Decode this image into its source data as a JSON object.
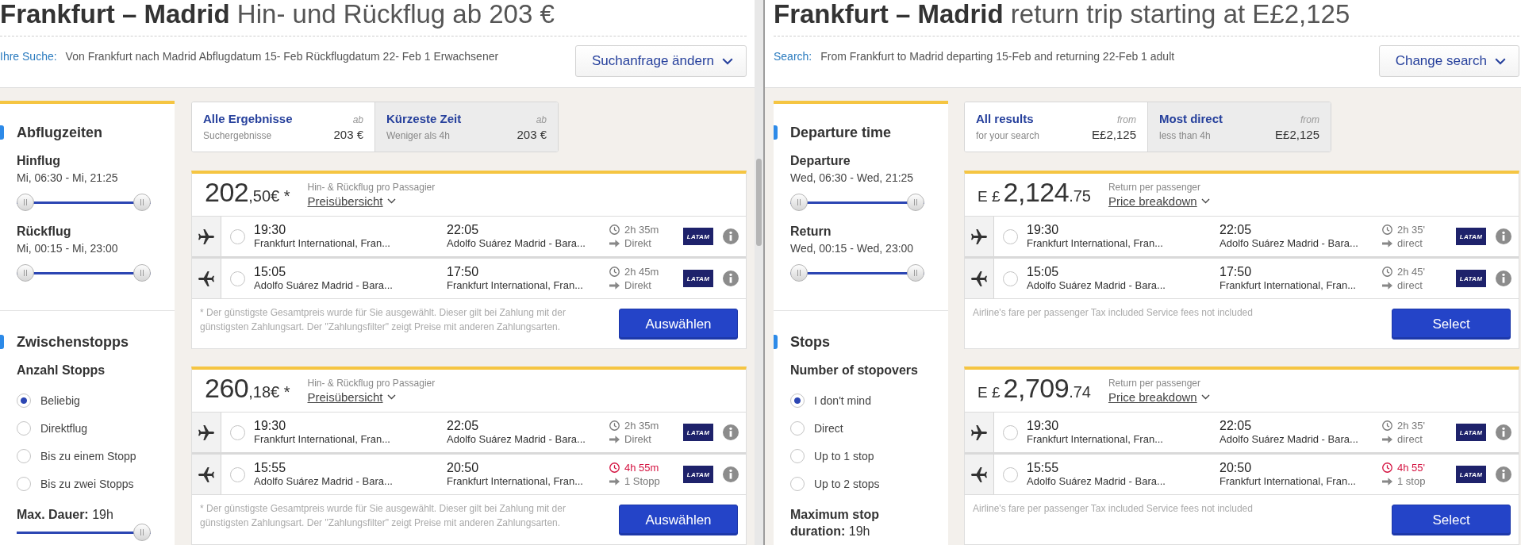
{
  "panes": [
    {
      "title": "**Frankfurt – Madrid** Hin- und Rückflug ab 203 €",
      "search": {
        "label": "Ihre Suche:",
        "summary": "Von Frankfurt nach Madrid Abflugdatum 15- Feb Rückflugdatum 22- Feb 1 Erwachsener",
        "button": "Suchanfrage ändern"
      },
      "sidebar": {
        "times": {
          "heading": "Abflugzeiten",
          "groups": [
            {
              "label": "Hinflug",
              "range": "Mi, 06:30 - Mi, 21:25",
              "level": 1
            },
            {
              "label": "Rückflug",
              "range": "Mi, 00:15 - Mi, 23:00",
              "level": 1
            }
          ]
        },
        "stops": {
          "heading": "Zwischenstopps",
          "subheading": "Anzahl Stopps",
          "options": [
            {
              "label": "Beliebig",
              "selected": true
            },
            {
              "label": "Direktflug",
              "selected": false
            },
            {
              "label": "Bis zu einem Stopp",
              "selected": false
            },
            {
              "label": "Bis zu zwei Stopps",
              "selected": false
            }
          ],
          "max_duration": "**Max. Dauer:** 19h",
          "level": 1
        }
      },
      "tabs": [
        {
          "title": "Alle Ergebnisse",
          "subtitle": "Suchergebnisse",
          "prefix": "ab",
          "price": "203 €",
          "selected": true
        },
        {
          "title": "Kürzeste Zeit",
          "subtitle": "Weniger als 4h",
          "prefix": "ab",
          "price": "203 €",
          "selected": false
        }
      ],
      "results": [
        {
          "price": {
            "amount": "202",
            "fraction": ",50€ *"
          },
          "fare_label": "Hin- & Rückflug pro Passagier",
          "breakdown": "Preisübersicht",
          "legs": [
            {
              "kind": "outbound",
              "selected": false,
              "depart_time": "19:30",
              "depart_airport": "Frankfurt International, Fran...",
              "arrive_time": "22:05",
              "arrive_airport": "Adolfo Suárez Madrid - Bara...",
              "duration": "2h 35m",
              "alert": false,
              "stops": "Direkt",
              "airline": "LATAM"
            },
            {
              "kind": "return",
              "selected": false,
              "depart_time": "15:05",
              "depart_airport": "Adolfo Suárez Madrid - Bara...",
              "arrive_time": "17:50",
              "arrive_airport": "Frankfurt International, Fran...",
              "duration": "2h 45m",
              "alert": false,
              "stops": "Direkt",
              "airline": "LATAM"
            }
          ],
          "note": "* Der günstigste Gesamtpreis wurde für Sie ausgewählt. Dieser gilt bei Zahlung mit der günstigsten Zahlungsart. Der \"Zahlungsfilter\" zeigt Preise mit anderen Zahlungsarten.",
          "button": "Auswählen"
        },
        {
          "price": {
            "amount": "260",
            "fraction": ",18€ *"
          },
          "fare_label": "Hin- & Rückflug pro Passagier",
          "breakdown": "Preisübersicht",
          "legs": [
            {
              "kind": "outbound",
              "selected": false,
              "depart_time": "19:30",
              "depart_airport": "Frankfurt International, Fran...",
              "arrive_time": "22:05",
              "arrive_airport": "Adolfo Suárez Madrid - Bara...",
              "duration": "2h 35m",
              "alert": false,
              "stops": "Direkt",
              "airline": "LATAM"
            },
            {
              "kind": "return",
              "selected": false,
              "depart_time": "15:55",
              "depart_airport": "Adolfo Suárez Madrid - Bara...",
              "arrive_time": "20:50",
              "arrive_airport": "Frankfurt International, Fran...",
              "duration": "4h 55m",
              "alert": true,
              "stops": "1 Stopp",
              "airline": "LATAM"
            }
          ],
          "note": "* Der günstigste Gesamtpreis wurde für Sie ausgewählt. Dieser gilt bei Zahlung mit der günstigsten Zahlungsart. Der \"Zahlungsfilter\" zeigt Preise mit anderen Zahlungsarten.",
          "button": "Auswählen"
        }
      ]
    },
    {
      "title": "**Frankfurt – Madrid** return trip starting at E£2,125",
      "search": {
        "label": "Search:",
        "summary": "From Frankfurt to Madrid departing 15-Feb and returning 22-Feb 1 adult",
        "button": "Change search"
      },
      "sidebar": {
        "times": {
          "heading": "Departure time",
          "groups": [
            {
              "label": "Departure",
              "range": "Wed, 06:30 - Wed, 21:25",
              "level": 1
            },
            {
              "label": "Return",
              "range": "Wed, 00:15 - Wed, 23:00",
              "level": 1
            }
          ]
        },
        "stops": {
          "heading": "Stops",
          "subheading": "Number of stopovers",
          "options": [
            {
              "label": "I don't mind",
              "selected": true
            },
            {
              "label": "Direct",
              "selected": false
            },
            {
              "label": "Up to 1 stop",
              "selected": false
            },
            {
              "label": "Up to 2 stops",
              "selected": false
            }
          ],
          "max_duration": "**Maximum stop duration:** 19h"
        }
      },
      "tabs": [
        {
          "title": "All results",
          "subtitle": "for your search",
          "prefix": "from",
          "price": "E£2,125",
          "selected": true
        },
        {
          "title": "Most direct",
          "subtitle": "less than 4h",
          "prefix": "from",
          "price": "E£2,125",
          "selected": false
        }
      ],
      "results": [
        {
          "price": {
            "currency": "E £",
            "amount": "2,124",
            "fraction": ".75"
          },
          "fare_label": "Return per passenger",
          "breakdown": "Price breakdown",
          "legs": [
            {
              "kind": "outbound",
              "selected": false,
              "depart_time": "19:30",
              "depart_airport": "Frankfurt International, Fran...",
              "arrive_time": "22:05",
              "arrive_airport": "Adolfo Suárez Madrid - Bara...",
              "duration": "2h 35'",
              "alert": false,
              "stops": "direct",
              "airline": "LATAM"
            },
            {
              "kind": "return",
              "selected": false,
              "depart_time": "15:05",
              "depart_airport": "Adolfo Suárez Madrid - Bara...",
              "arrive_time": "17:50",
              "arrive_airport": "Frankfurt International, Fran...",
              "duration": "2h 45'",
              "alert": false,
              "stops": "direct",
              "airline": "LATAM"
            }
          ],
          "note": "Airline's fare per passenger Tax included Service fees not included",
          "button": "Select"
        },
        {
          "price": {
            "currency": "E £",
            "amount": "2,709",
            "fraction": ".74"
          },
          "fare_label": "Return per passenger",
          "breakdown": "Price breakdown",
          "legs": [
            {
              "kind": "outbound",
              "selected": false,
              "depart_time": "19:30",
              "depart_airport": "Frankfurt International, Fran...",
              "arrive_time": "22:05",
              "arrive_airport": "Adolfo Suárez Madrid - Bara...",
              "duration": "2h 35'",
              "alert": false,
              "stops": "direct",
              "airline": "LATAM"
            },
            {
              "kind": "return",
              "selected": false,
              "depart_time": "15:55",
              "depart_airport": "Adolfo Suárez Madrid - Bara...",
              "arrive_time": "20:50",
              "arrive_airport": "Frankfurt International, Fran...",
              "duration": "4h 55'",
              "alert": true,
              "stops": "1 stop",
              "airline": "LATAM"
            }
          ],
          "note": "Airline's fare per passenger Tax included Service fees not included",
          "button": "Select"
        }
      ]
    }
  ]
}
